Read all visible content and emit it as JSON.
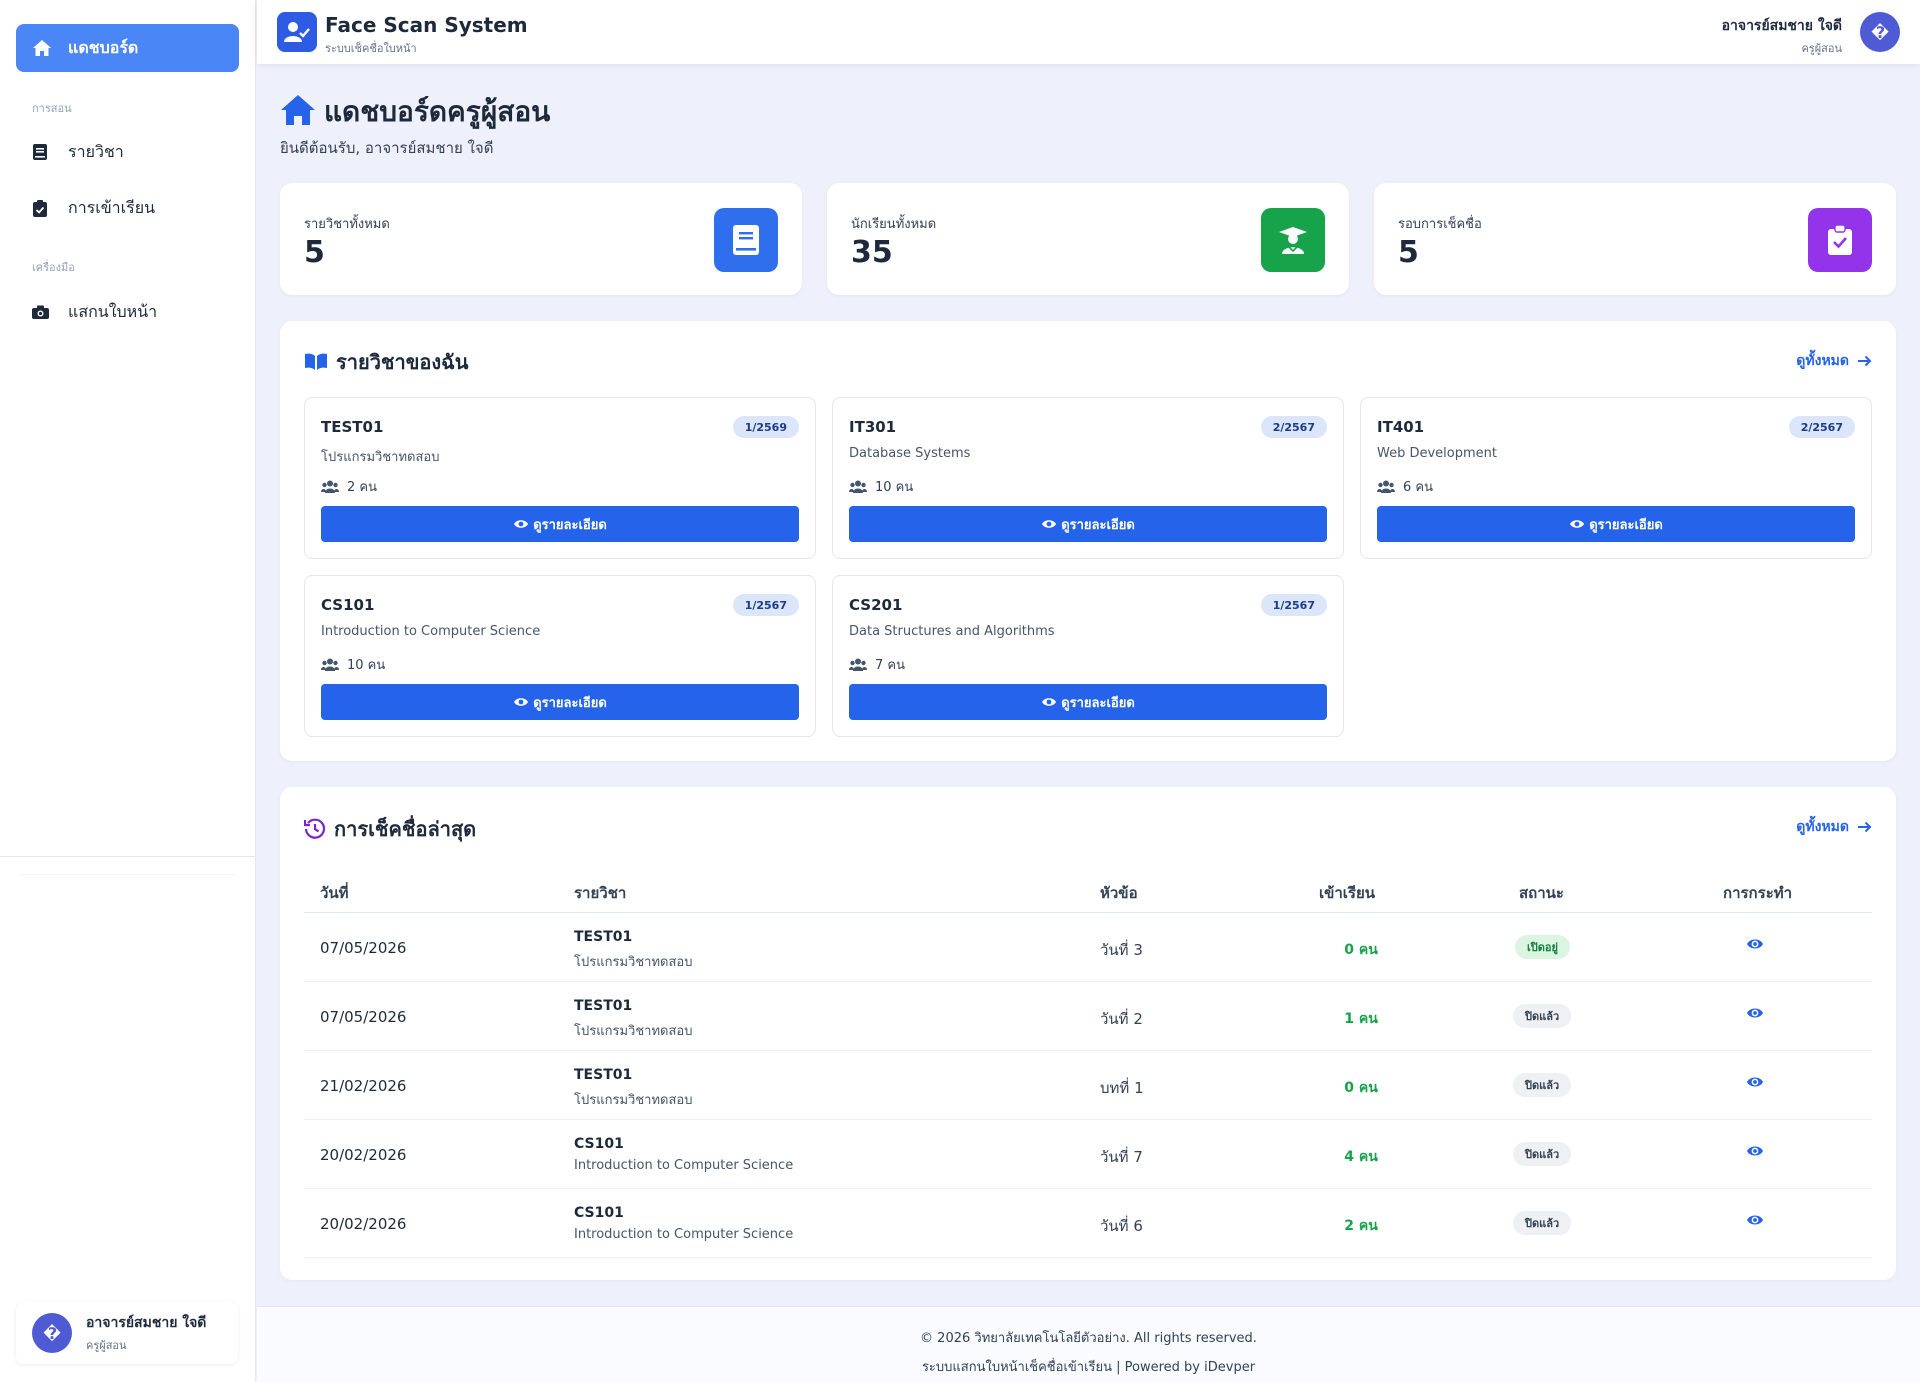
{
  "sidebar": {
    "active": {
      "label": "แดชบอร์ด",
      "icon": "home-icon"
    },
    "sections": [
      {
        "title": "การสอน",
        "items": [
          {
            "label": "รายวิชา",
            "icon": "book-icon"
          },
          {
            "label": "การเข้าเรียน",
            "icon": "clipboard-check-icon"
          }
        ]
      },
      {
        "title": "เครื่องมือ",
        "items": [
          {
            "label": "แสกนใบหน้า",
            "icon": "camera-icon"
          }
        ]
      }
    ],
    "user": {
      "avatar": "�",
      "name": "อาจารย์สมชาย ใจดี",
      "role": "ครูผู้สอน"
    }
  },
  "header": {
    "app_title": "Face Scan System",
    "app_subtitle": "ระบบเช็คชื่อใบหน้า",
    "user_name": "อาจารย์สมชาย ใจดี",
    "user_role": "ครูผู้สอน",
    "avatar": "�"
  },
  "page": {
    "title": "แดชบอร์ดครูผู้สอน",
    "subtitle": "ยินดีต้อนรับ, อาจารย์สมชาย ใจดี"
  },
  "stats": [
    {
      "label": "รายวิชาทั้งหมด",
      "value": "5",
      "icon": "book-icon",
      "color": "#2f6fed"
    },
    {
      "label": "นักเรียนทั้งหมด",
      "value": "35",
      "icon": "graduate-icon",
      "color": "#16a34a"
    },
    {
      "label": "รอบการเช็คชื่อ",
      "value": "5",
      "icon": "clipboard-check-icon",
      "color": "#9333ea"
    }
  ],
  "courses_section": {
    "title": "รายวิชาของฉัน",
    "view_all": "ดูทั้งหมด",
    "detail_label": "ดูรายละเอียด",
    "courses": [
      {
        "code": "TEST01",
        "term": "1/2569",
        "name": "โปรแกรมวิชาทดสอบ",
        "students": "2 คน"
      },
      {
        "code": "IT301",
        "term": "2/2567",
        "name": "Database Systems",
        "students": "10 คน"
      },
      {
        "code": "IT401",
        "term": "2/2567",
        "name": "Web Development",
        "students": "6 คน"
      },
      {
        "code": "CS101",
        "term": "1/2567",
        "name": "Introduction to Computer Science",
        "students": "10 คน"
      },
      {
        "code": "CS201",
        "term": "1/2567",
        "name": "Data Structures and Algorithms",
        "students": "7 คน"
      }
    ]
  },
  "recent_section": {
    "title": "การเช็คชื่อล่าสุด",
    "view_all": "ดูทั้งหมด",
    "headers": {
      "date": "วันที่",
      "course": "รายวิชา",
      "topic": "หัวข้อ",
      "attend": "เข้าเรียน",
      "status": "สถานะ",
      "action": "การกระทำ"
    },
    "rows": [
      {
        "date": "07/05/2026",
        "code": "TEST01",
        "name": "โปรแกรมวิชาทดสอบ",
        "topic": "วันที่ 3",
        "attend": "0 คน",
        "status": "เปิดอยู่",
        "open": true
      },
      {
        "date": "07/05/2026",
        "code": "TEST01",
        "name": "โปรแกรมวิชาทดสอบ",
        "topic": "วันที่ 2",
        "attend": "1 คน",
        "status": "ปิดแล้ว",
        "open": false
      },
      {
        "date": "21/02/2026",
        "code": "TEST01",
        "name": "โปรแกรมวิชาทดสอบ",
        "topic": "บทที่ 1",
        "attend": "0 คน",
        "status": "ปิดแล้ว",
        "open": false
      },
      {
        "date": "20/02/2026",
        "code": "CS101",
        "name": "Introduction to Computer Science",
        "topic": "วันที่ 7",
        "attend": "4 คน",
        "status": "ปิดแล้ว",
        "open": false
      },
      {
        "date": "20/02/2026",
        "code": "CS101",
        "name": "Introduction to Computer Science",
        "topic": "วันที่ 6",
        "attend": "2 คน",
        "status": "ปิดแล้ว",
        "open": false
      }
    ]
  },
  "footer": {
    "copyright": "© 2026 วิทยาลัยเทคโนโลยีตัวอย่าง. All rights reserved.",
    "powered": "ระบบแสกนใบหน้าเช็คชื่อเข้าเรียน | Powered by iDevper"
  }
}
